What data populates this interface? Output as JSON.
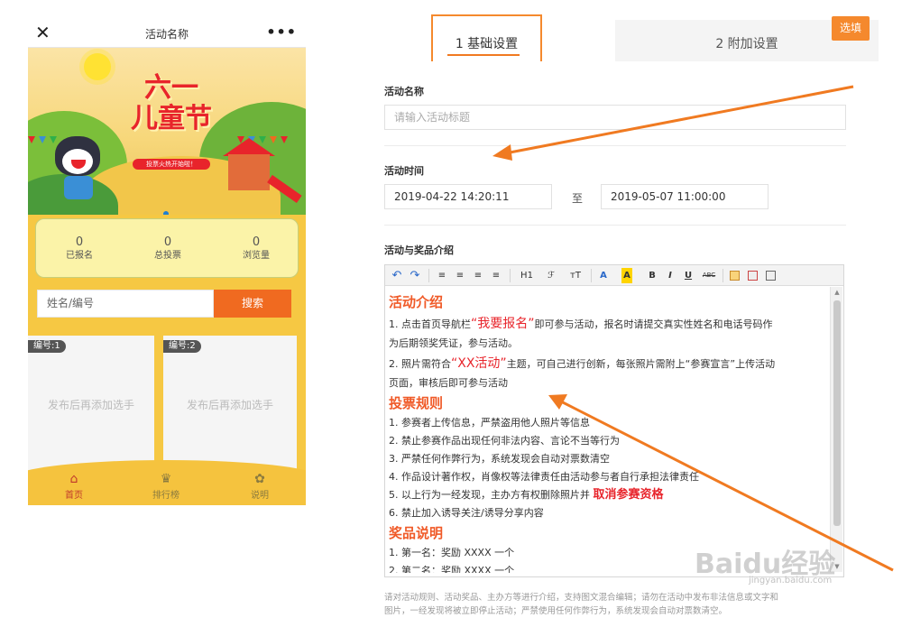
{
  "colors": {
    "accent": "#f07a21",
    "brand_red": "#e8242b",
    "phone_yellow": "#f6c843"
  },
  "phone": {
    "title": "活动名称",
    "close_icon": "close-icon",
    "more_icon": "more-icon",
    "banner_title_line1": "六一",
    "banner_title_line2": "儿童节",
    "banner_subtitle": "投票火热开始啦！",
    "stats": [
      {
        "value": "0",
        "label": "已报名"
      },
      {
        "value": "0",
        "label": "总投票"
      },
      {
        "value": "0",
        "label": "浏览量"
      }
    ],
    "search": {
      "placeholder": "姓名/编号",
      "button": "搜索"
    },
    "cards": [
      {
        "tag": "编号:1",
        "text": "发布后再添加选手"
      },
      {
        "tag": "编号:2",
        "text": "发布后再添加选手"
      }
    ],
    "tabbar": [
      {
        "label": "首页",
        "icon": "home-icon"
      },
      {
        "label": "排行榜",
        "icon": "trophy-icon"
      },
      {
        "label": "说明",
        "icon": "info-icon"
      }
    ]
  },
  "settings": {
    "tabs": [
      "1 基础设置",
      "2 附加设置"
    ],
    "options_button": "选填",
    "activity_name": {
      "label": "活动名称",
      "placeholder": "请输入活动标题"
    },
    "activity_time": {
      "label": "活动时间",
      "start": "2019-04-22 14:20:11",
      "to": "至",
      "end": "2019-05-07 11:00:00"
    },
    "intro": {
      "label": "活动与奖品介绍",
      "toolbar": [
        "H1",
        "ℱ",
        "тT",
        "A",
        "A",
        "B",
        "I",
        "U",
        "ABC"
      ],
      "sections": {
        "activity_title": "活动介绍",
        "a1_pre": "1. 点击首页导航栏",
        "a1_highlight": "“我要报名”",
        "a1_post": "即可参与活动，报名时请提交真实性姓名和电话号码作",
        "a1_cont": "为后期领奖凭证，参与活动。",
        "a2_pre": "2. 照片需符合",
        "a2_highlight": "“XX活动”",
        "a2_post": "主题，可自己进行创新，每张照片需附上“参赛宣言”上传活动",
        "a2_cont": "页面，审核后即可参与活动",
        "vote_title": "投票规则",
        "v1": "1. 参赛者上传信息，严禁盗用他人照片等信息",
        "v2": "2. 禁止参赛作品出现任何非法内容、言论不当等行为",
        "v3": "3. 严禁任何作弊行为，系统发现会自动对票数清空",
        "v4": "4. 作品设计著作权，肖像权等法律责任由活动参与者自行承担法律责任",
        "v5_pre": "5. 以上行为一经发现，主办方有权删除照片并",
        "v5_highlight": "取消参赛资格",
        "v6": "6. 禁止加入诱导关注/诱导分享内容",
        "prize_title": "奖品说明",
        "p1": "1. 第一名：奖励 XXXX 一个",
        "p2": "2. 第二名：奖励 XXXX 一个"
      },
      "hint_line1": "请对活动规则、活动奖品、主办方等进行介绍，支持图文混合编辑；请勿在活动中发布非法信息或文字和",
      "hint_line2": "图片，一经发现将被立即停止活动；严禁使用任何作弊行为，系统发现会自动对票数清空。"
    }
  },
  "watermark": {
    "text": "Baidu经验",
    "sub": "jingyan.baidu.com"
  }
}
